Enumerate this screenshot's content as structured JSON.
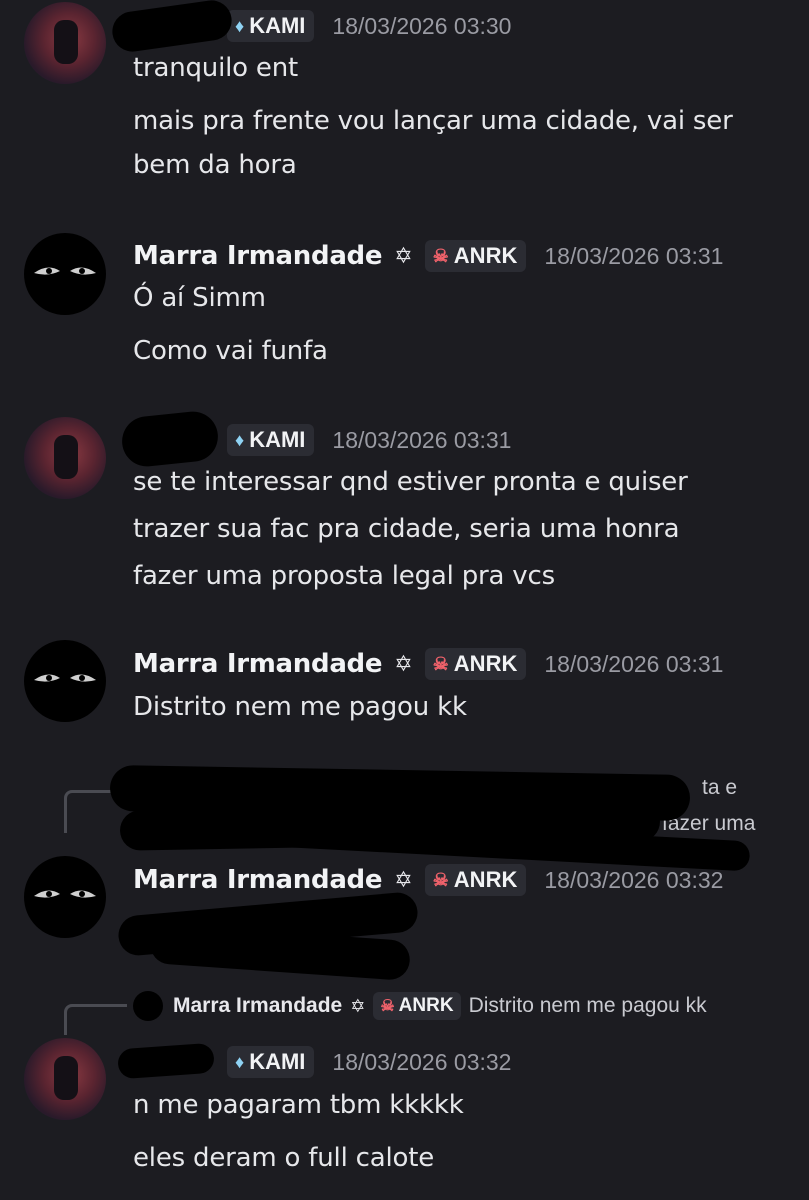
{
  "messages": [
    {
      "author": "",
      "tag": "KAMI",
      "timestamp": "18/03/2026 03:30",
      "lines": [
        "tranquilo ent",
        "mais pra frente vou lançar uma cidade, vai ser",
        "bem da hora"
      ]
    },
    {
      "author": "Marra Irmandade",
      "badge": "✡",
      "tag": "ANRK",
      "timestamp": "18/03/2026 03:31",
      "lines": [
        "Ó aí Simm",
        "Como vai funfa"
      ]
    },
    {
      "author": "",
      "tag": "KAMI",
      "timestamp": "18/03/2026 03:31",
      "lines": [
        "se te interessar qnd estiver pronta e quiser",
        "trazer sua fac pra cidade, seria uma honra",
        "fazer uma proposta legal pra vcs"
      ]
    },
    {
      "author": "Marra Irmandade",
      "badge": "✡",
      "tag": "ANRK",
      "timestamp": "18/03/2026 03:31",
      "lines": [
        "Distrito nem me pagou kk"
      ]
    },
    {
      "reply_fragments": [
        "ta e",
        "fazer uma"
      ],
      "author": "Marra Irmandade",
      "badge": "✡",
      "tag": "ANRK",
      "timestamp": "18/03/2026 03:32",
      "lines": []
    },
    {
      "reply": {
        "author": "Marra Irmandade",
        "badge": "✡",
        "tag": "ANRK",
        "text": "Distrito nem me pagou kk"
      },
      "author": "",
      "tag": "KAMI",
      "timestamp": "18/03/2026 03:32",
      "lines": [
        "n me pagaram tbm kkkkk",
        "eles deram o full calote"
      ]
    }
  ],
  "icons": {
    "kami_tag": "gem-icon",
    "anrk_tag": "skull-icon",
    "badge": "star-of-david-icon"
  },
  "colors": {
    "background": "#1c1c21",
    "tag_background": "#2b2c33",
    "timestamp": "#9a9ba3",
    "skull": "#f0626b",
    "gem": "#8fd3f4"
  }
}
